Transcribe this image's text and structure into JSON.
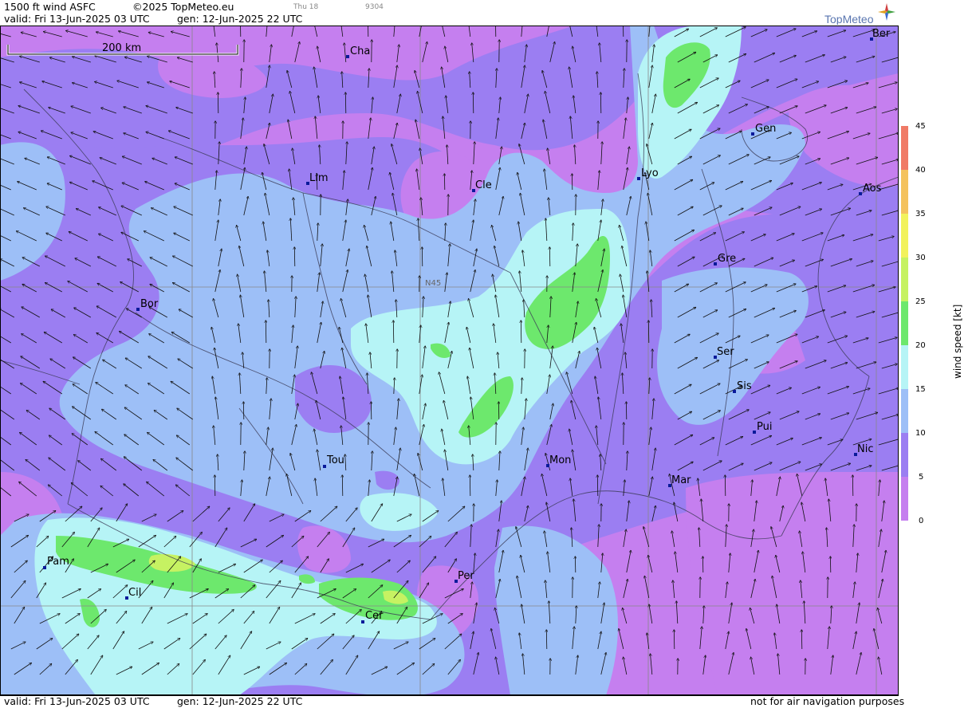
{
  "header": {
    "product": "1500 ft wind ASFC",
    "copyright": "©2025 TopMeteo.eu",
    "faint_day": "Thu 18",
    "faint_code": "9304",
    "valid": "valid:  Fri  13-Jun-2025  03 UTC",
    "gen": "gen: 12-Jun-2025 22 UTC",
    "logo_text": "TopMeteo"
  },
  "footer": {
    "valid": "valid:  Fri  13-Jun-2025  03 UTC",
    "gen": "gen: 12-Jun-2025 22 UTC",
    "disclaimer": "not for air navigation purposes"
  },
  "map": {
    "scale_label": "200 km",
    "grid_label": "N45",
    "cities": [
      {
        "id": "cha",
        "name": "Cha"
      },
      {
        "id": "ber",
        "name": "Ber"
      },
      {
        "id": "gen",
        "name": "Gen"
      },
      {
        "id": "lim",
        "name": "Lim"
      },
      {
        "id": "cle",
        "name": "Cle"
      },
      {
        "id": "lyo",
        "name": "Lyo"
      },
      {
        "id": "aos",
        "name": "Aos"
      },
      {
        "id": "gre",
        "name": "Gre"
      },
      {
        "id": "bor",
        "name": "Bor"
      },
      {
        "id": "ser",
        "name": "Ser"
      },
      {
        "id": "sis",
        "name": "Sis"
      },
      {
        "id": "pui",
        "name": "Pui"
      },
      {
        "id": "tou",
        "name": "Tou"
      },
      {
        "id": "mon",
        "name": "Mon"
      },
      {
        "id": "nic",
        "name": "Nic"
      },
      {
        "id": "mar",
        "name": "Mar"
      },
      {
        "id": "pam",
        "name": "Pam"
      },
      {
        "id": "cil",
        "name": "Cil"
      },
      {
        "id": "per",
        "name": "Per"
      },
      {
        "id": "cer",
        "name": "Cer"
      }
    ]
  },
  "legend": {
    "title": "wind speed [kt]",
    "ticks": [
      "45",
      "40",
      "35",
      "30",
      "25",
      "20",
      "15",
      "10",
      "5",
      "0"
    ],
    "colors": {
      "0-5": "#c57fef",
      "5-10": "#9b7ef2",
      "10-15": "#9dbff7",
      "15-20": "#b6f4f6",
      "20-25": "#6de86d",
      "25-30": "#c6f262",
      "30-35": "#f2f25c",
      "35-40": "#f4c25e",
      "40-45": "#f07a66"
    }
  }
}
